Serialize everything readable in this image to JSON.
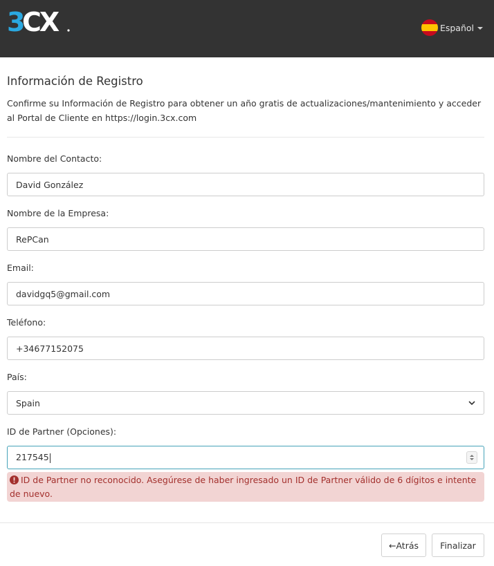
{
  "header": {
    "logo_text": "3CX",
    "language": "Español"
  },
  "page": {
    "title": "Información de Registro",
    "description": "Confirme su Información de Registro para obtener un año gratis de actualizaciones/mantenimiento y acceder al Portal de Cliente en https://login.3cx.com"
  },
  "form": {
    "contact_name": {
      "label": "Nombre del Contacto:",
      "value": "David González"
    },
    "company": {
      "label": "Nombre de la Empresa:",
      "value": "RePCan"
    },
    "email": {
      "label": "Email:",
      "value": "davidgq5@gmail.com"
    },
    "phone": {
      "label": "Teléfono:",
      "value": "+34677152075"
    },
    "country": {
      "label": "País:",
      "value": "Spain"
    },
    "partner_id": {
      "label": "ID de Partner (Opciones):",
      "value": "217545"
    }
  },
  "error": {
    "message": "ID de Partner no reconocido. Asegúrese de haber ingresado un ID de Partner válido de 6 dígitos e intente de nuevo."
  },
  "buttons": {
    "back": "←Atrás",
    "finish": "Finalizar"
  },
  "colors": {
    "header_bg": "#333333",
    "logo_blue": "#2aa8e0",
    "error_bg": "#f2d4d3",
    "error_text": "#a3302d",
    "focus_border": "#45a2b8"
  }
}
